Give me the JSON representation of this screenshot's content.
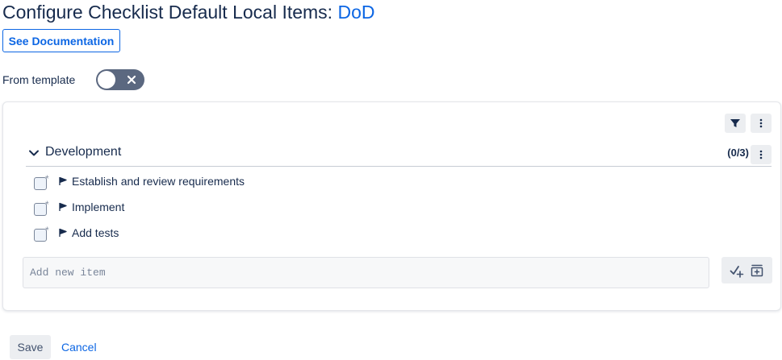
{
  "page": {
    "title_prefix": "Configure Checklist Default Local Items: ",
    "title_accent": "DoD",
    "doc_button_label": "See Documentation"
  },
  "template": {
    "label": "From template",
    "toggle_on": false
  },
  "toolbar": {
    "filter_icon": "filter-icon",
    "more_icon": "more-vertical-icon"
  },
  "section": {
    "title": "Development",
    "count": "(0/3)",
    "expanded": true,
    "items": [
      {
        "label": "Establish and review requirements",
        "checked": false
      },
      {
        "label": "Implement",
        "checked": false
      },
      {
        "label": "Add tests",
        "checked": false
      }
    ]
  },
  "add_item": {
    "placeholder": "Add new item",
    "value": ""
  },
  "footer": {
    "save_label": "Save",
    "cancel_label": "Cancel"
  },
  "colors": {
    "accent": "#0c66e4",
    "toggle_off": "#5b6880",
    "text": "#172b4d"
  }
}
